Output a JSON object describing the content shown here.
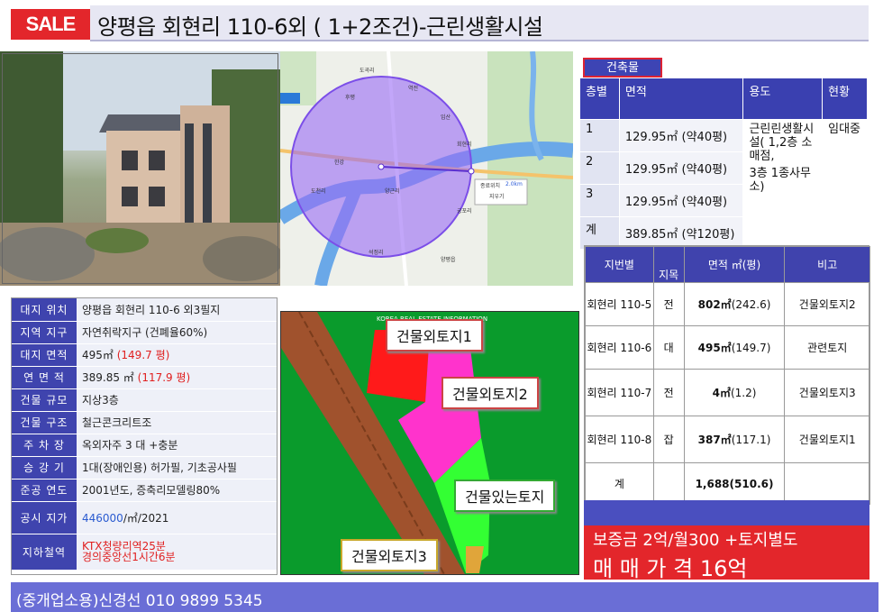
{
  "header": {
    "badge": "SALE",
    "title": "양평읍 회현리 110-6외 ( 1+2조건)-근린생활시설"
  },
  "map": {
    "labels": [
      "도곡리",
      "한강",
      "역전",
      "임산",
      "회현리",
      "후평",
      "도천리",
      "궁포리",
      "석정리",
      "양근리",
      "양평읍"
    ],
    "popup_distance": "2.0km",
    "popup_label": "종료위치",
    "popup_button": "지우기"
  },
  "building": {
    "tab": "건축물",
    "headers": [
      "층별",
      "면적",
      "용도",
      "현황"
    ],
    "rows": [
      {
        "floor": "1",
        "area": "129.95㎡ (약40평)"
      },
      {
        "floor": "2",
        "area": "129.95㎡ (약40평)"
      },
      {
        "floor": "3",
        "area": "129.95㎡ (약40평)"
      },
      {
        "floor": "계",
        "area": "389.85㎡ (약120평)"
      }
    ],
    "use_text_1": "근린린생활시설( 1,2층 소매점,",
    "use_text_2": "3층 1종사무소)",
    "status": "임대중"
  },
  "lots": {
    "headers": [
      "지번별",
      "지목",
      "면적 ㎡(평)",
      "비고"
    ],
    "rows": [
      {
        "lot": "회현리 110-5",
        "type": "전",
        "area": "802㎡",
        "pyeong": "(242.6)",
        "note": "건물외토지2"
      },
      {
        "lot": "회현리 110-6",
        "type": "대",
        "area": "495㎡",
        "pyeong": "(149.7)",
        "note": "관련토지"
      },
      {
        "lot": "회현리 110-7",
        "type": "전",
        "area": "4㎡",
        "pyeong": "(1.2)",
        "note": "건물외토지3"
      },
      {
        "lot": "회현리 110-8",
        "type": "잡",
        "area": "387㎡",
        "pyeong": "(117.1)",
        "note": "건물외토지1"
      }
    ],
    "total_label": "계",
    "total_area": "1,688(510.6)"
  },
  "price": {
    "line1": "보증금 2억/월300 +토지별도",
    "line2": "매 매 가 격 16억"
  },
  "info": [
    {
      "key": "대지 위치",
      "value": "양평읍 회현리 110-6 외3필지"
    },
    {
      "key": "지역 지구",
      "value": "자연취락지구 (건폐율60%)"
    },
    {
      "key": "대지 면적",
      "value": "495㎡",
      "extra": "(149.7 평)"
    },
    {
      "key": "연 면 적",
      "value": "389.85 ㎡",
      "extra": "(117.9 평)"
    },
    {
      "key": "건물 규모",
      "value": "지상3층"
    },
    {
      "key": "건물 구조",
      "value": "철근콘크리트조"
    },
    {
      "key": "주 차 장",
      "value": "옥외자주 3 대 +충분"
    },
    {
      "key": "승 강 기",
      "value": "1대(장애인용) 허가필, 기초공사필"
    },
    {
      "key": "준공 연도",
      "value": "2001년도, 증축리모델링80%"
    },
    {
      "key": "공시 지가",
      "value_blue": "446000",
      "value": "/㎡/2021"
    },
    {
      "key": "지하철역",
      "value_red1": "KTX청량리역25분",
      "value_red2": "경의중앙선1시간6분"
    }
  ],
  "plan": {
    "labels": [
      "건물외토지1",
      "건물외토지2",
      "건물있는토지",
      "건물외토지3"
    ],
    "watermark": "KOREA REAL ESTATE INFORMATION"
  },
  "footer": {
    "text": "(중개업소용)신경선 010 9899 5345"
  },
  "colors": {
    "accent_blue": "#3f44ae",
    "sale_red": "#e3262b",
    "footer_purple": "#6a6ed6",
    "plan_green": "#0a9b2c"
  }
}
